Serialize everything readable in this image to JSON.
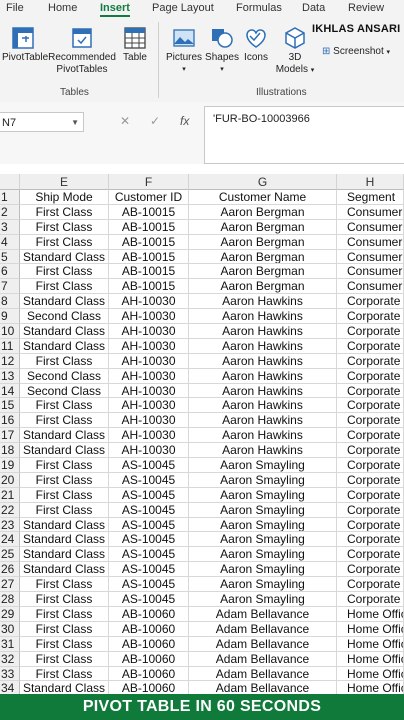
{
  "ribbon_tabs": [
    "File",
    "Home",
    "Insert",
    "Page Layout",
    "Formulas",
    "Data",
    "Review"
  ],
  "active_tab": "Insert",
  "user_name": "IKHLAS ANSARI",
  "ribbon": {
    "pivottable": "PivotTable",
    "recommended_1": "Recommended",
    "recommended_2": "PivotTables",
    "table": "Table",
    "tables_group": "Tables",
    "pictures": "Pictures",
    "shapes": "Shapes",
    "icons": "Icons",
    "models_1": "3D",
    "models_2": "Models",
    "screenshot": "Screenshot",
    "illustrations_group": "Illustrations"
  },
  "formula_bar": {
    "name_box": "N7",
    "cancel": "✕",
    "enter": "✓",
    "fx": "fx",
    "content": "'FUR-BO-10003966"
  },
  "columns": [
    "E",
    "F",
    "G",
    "H"
  ],
  "header_row": {
    "row": "1",
    "e": "Ship Mode",
    "f": "Customer ID",
    "g": "Customer Name",
    "h": "Segment"
  },
  "rows": [
    {
      "row": "2",
      "e": "First Class",
      "f": "AB-10015",
      "g": "Aaron Bergman",
      "h": "Consumer"
    },
    {
      "row": "3",
      "e": "First Class",
      "f": "AB-10015",
      "g": "Aaron Bergman",
      "h": "Consumer"
    },
    {
      "row": "4",
      "e": "First Class",
      "f": "AB-10015",
      "g": "Aaron Bergman",
      "h": "Consumer"
    },
    {
      "row": "5",
      "e": "Standard Class",
      "f": "AB-10015",
      "g": "Aaron Bergman",
      "h": "Consumer"
    },
    {
      "row": "6",
      "e": "First Class",
      "f": "AB-10015",
      "g": "Aaron Bergman",
      "h": "Consumer"
    },
    {
      "row": "7",
      "e": "First Class",
      "f": "AB-10015",
      "g": "Aaron Bergman",
      "h": "Consumer"
    },
    {
      "row": "8",
      "e": "Standard Class",
      "f": "AH-10030",
      "g": "Aaron Hawkins",
      "h": "Corporate"
    },
    {
      "row": "9",
      "e": "Second Class",
      "f": "AH-10030",
      "g": "Aaron Hawkins",
      "h": "Corporate"
    },
    {
      "row": "10",
      "e": "Standard Class",
      "f": "AH-10030",
      "g": "Aaron Hawkins",
      "h": "Corporate"
    },
    {
      "row": "11",
      "e": "Standard Class",
      "f": "AH-10030",
      "g": "Aaron Hawkins",
      "h": "Corporate"
    },
    {
      "row": "12",
      "e": "First Class",
      "f": "AH-10030",
      "g": "Aaron Hawkins",
      "h": "Corporate"
    },
    {
      "row": "13",
      "e": "Second Class",
      "f": "AH-10030",
      "g": "Aaron Hawkins",
      "h": "Corporate"
    },
    {
      "row": "14",
      "e": "Second Class",
      "f": "AH-10030",
      "g": "Aaron Hawkins",
      "h": "Corporate"
    },
    {
      "row": "15",
      "e": "First Class",
      "f": "AH-10030",
      "g": "Aaron Hawkins",
      "h": "Corporate"
    },
    {
      "row": "16",
      "e": "First Class",
      "f": "AH-10030",
      "g": "Aaron Hawkins",
      "h": "Corporate"
    },
    {
      "row": "17",
      "e": "Standard Class",
      "f": "AH-10030",
      "g": "Aaron Hawkins",
      "h": "Corporate"
    },
    {
      "row": "18",
      "e": "Standard Class",
      "f": "AH-10030",
      "g": "Aaron Hawkins",
      "h": "Corporate"
    },
    {
      "row": "19",
      "e": "First Class",
      "f": "AS-10045",
      "g": "Aaron Smayling",
      "h": "Corporate"
    },
    {
      "row": "20",
      "e": "First Class",
      "f": "AS-10045",
      "g": "Aaron Smayling",
      "h": "Corporate"
    },
    {
      "row": "21",
      "e": "First Class",
      "f": "AS-10045",
      "g": "Aaron Smayling",
      "h": "Corporate"
    },
    {
      "row": "22",
      "e": "First Class",
      "f": "AS-10045",
      "g": "Aaron Smayling",
      "h": "Corporate"
    },
    {
      "row": "23",
      "e": "Standard Class",
      "f": "AS-10045",
      "g": "Aaron Smayling",
      "h": "Corporate"
    },
    {
      "row": "24",
      "e": "Standard Class",
      "f": "AS-10045",
      "g": "Aaron Smayling",
      "h": "Corporate"
    },
    {
      "row": "25",
      "e": "Standard Class",
      "f": "AS-10045",
      "g": "Aaron Smayling",
      "h": "Corporate"
    },
    {
      "row": "26",
      "e": "Standard Class",
      "f": "AS-10045",
      "g": "Aaron Smayling",
      "h": "Corporate"
    },
    {
      "row": "27",
      "e": "First Class",
      "f": "AS-10045",
      "g": "Aaron Smayling",
      "h": "Corporate"
    },
    {
      "row": "28",
      "e": "First Class",
      "f": "AS-10045",
      "g": "Aaron Smayling",
      "h": "Corporate"
    },
    {
      "row": "29",
      "e": "First Class",
      "f": "AB-10060",
      "g": "Adam Bellavance",
      "h": "Home Office"
    },
    {
      "row": "30",
      "e": "First Class",
      "f": "AB-10060",
      "g": "Adam Bellavance",
      "h": "Home Office"
    },
    {
      "row": "31",
      "e": "First Class",
      "f": "AB-10060",
      "g": "Adam Bellavance",
      "h": "Home Office"
    },
    {
      "row": "32",
      "e": "First Class",
      "f": "AB-10060",
      "g": "Adam Bellavance",
      "h": "Home Office"
    },
    {
      "row": "33",
      "e": "First Class",
      "f": "AB-10060",
      "g": "Adam Bellavance",
      "h": "Home Office"
    },
    {
      "row": "34",
      "e": "Standard Class",
      "f": "AB-10060",
      "g": "Adam Bellavance",
      "h": "Home Office"
    }
  ],
  "banner": "PIVOT TABLE IN 60 SECONDS",
  "colors": {
    "accent": "#107c41",
    "banner": "#0f7a3a",
    "icon_blue": "#2f6fb5"
  }
}
